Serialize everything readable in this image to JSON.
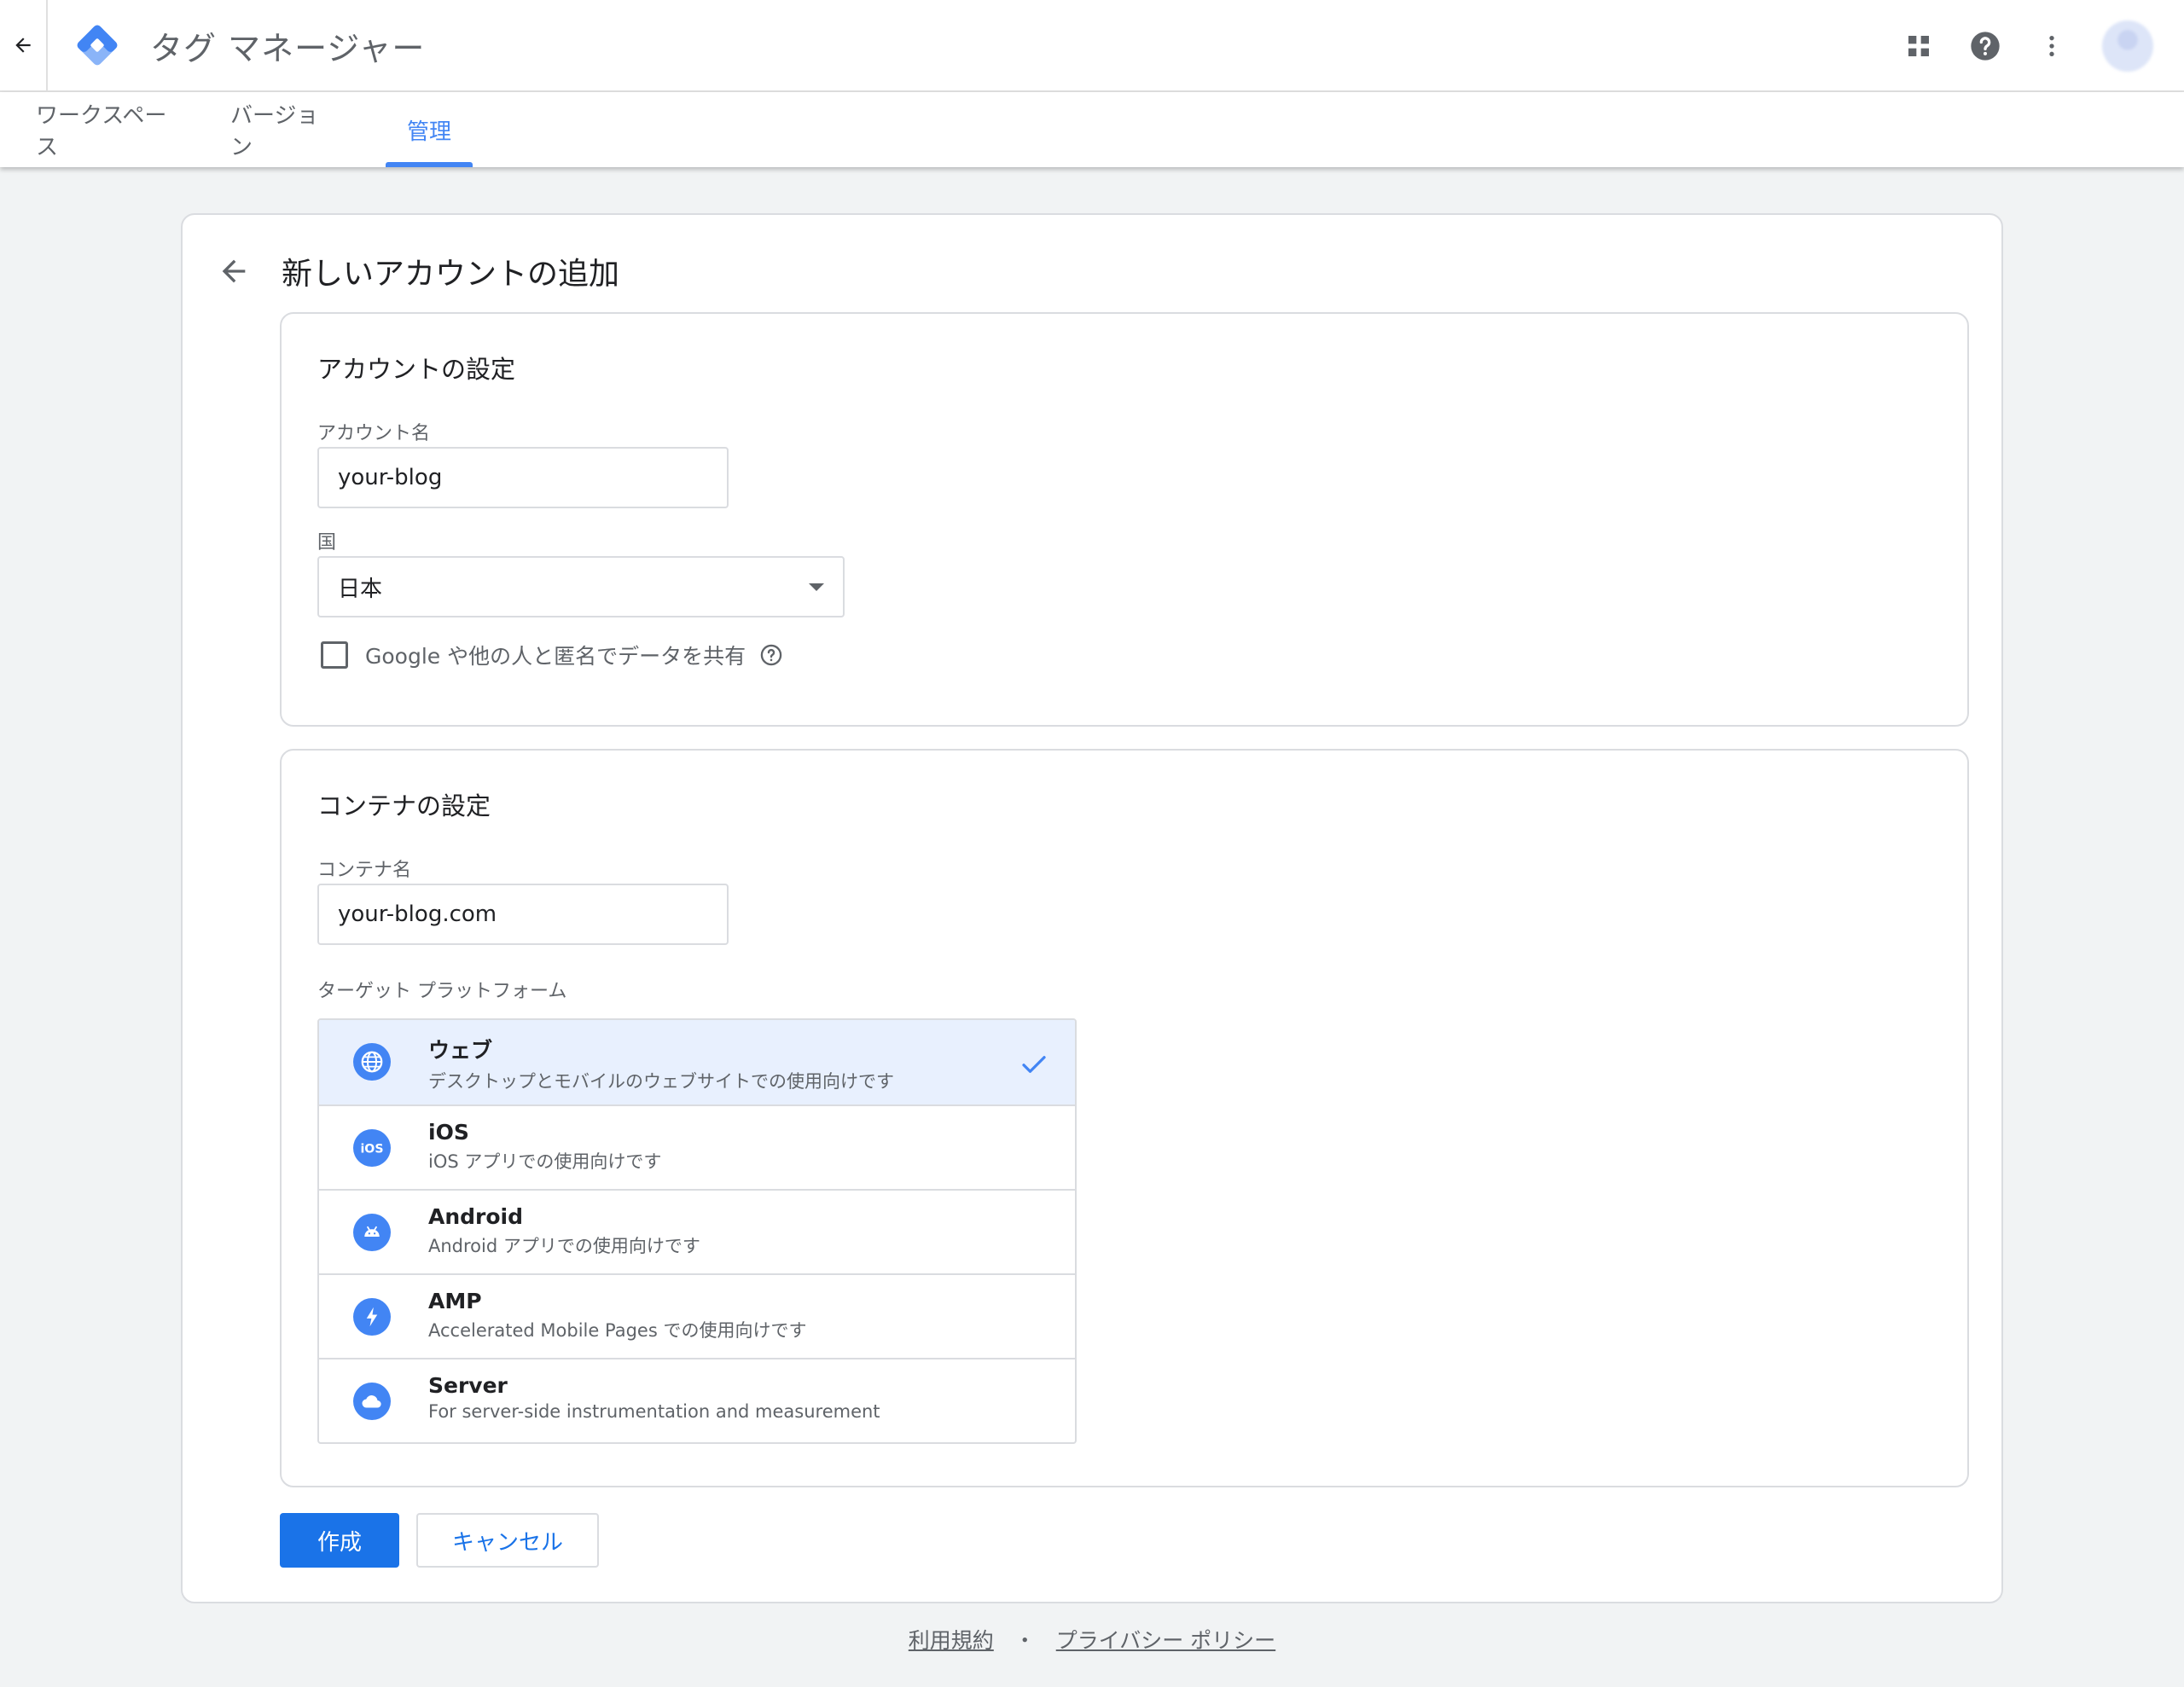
{
  "app": {
    "title": "タグ マネージャー"
  },
  "tabs": [
    {
      "label": "ワークスペース"
    },
    {
      "label": "バージョン"
    },
    {
      "label": "管理"
    }
  ],
  "page": {
    "title": "新しいアカウントの追加"
  },
  "account_section": {
    "title": "アカウントの設定",
    "name_label": "アカウント名",
    "name_value": "your-blog",
    "country_label": "国",
    "country_value": "日本",
    "share_label": "Google や他の人と匿名でデータを共有",
    "share_checked": false
  },
  "container_section": {
    "title": "コンテナの設定",
    "name_label": "コンテナ名",
    "name_value": "your-blog.com",
    "platform_label": "ターゲット プラットフォーム",
    "platforms": [
      {
        "name": "ウェブ",
        "desc": "デスクトップとモバイルのウェブサイトでの使用向けです",
        "icon": "web-globe-icon",
        "selected": true
      },
      {
        "name": "iOS",
        "desc": "iOS アプリでの使用向けです",
        "icon": "ios-icon",
        "selected": false
      },
      {
        "name": "Android",
        "desc": "Android アプリでの使用向けです",
        "icon": "android-icon",
        "selected": false
      },
      {
        "name": "AMP",
        "desc": "Accelerated Mobile Pages での使用向けです",
        "icon": "amp-bolt-icon",
        "selected": false
      },
      {
        "name": "Server",
        "desc": "For server-side instrumentation and measurement",
        "icon": "cloud-icon",
        "selected": false
      }
    ]
  },
  "buttons": {
    "create": "作成",
    "cancel": "キャンセル"
  },
  "footer": {
    "terms": "利用規約",
    "separator": "・",
    "privacy": "プライバシー ポリシー"
  },
  "colors": {
    "accent": "#4285f4",
    "primary_button": "#1a73e8",
    "selected_row": "#e8f0fe"
  }
}
